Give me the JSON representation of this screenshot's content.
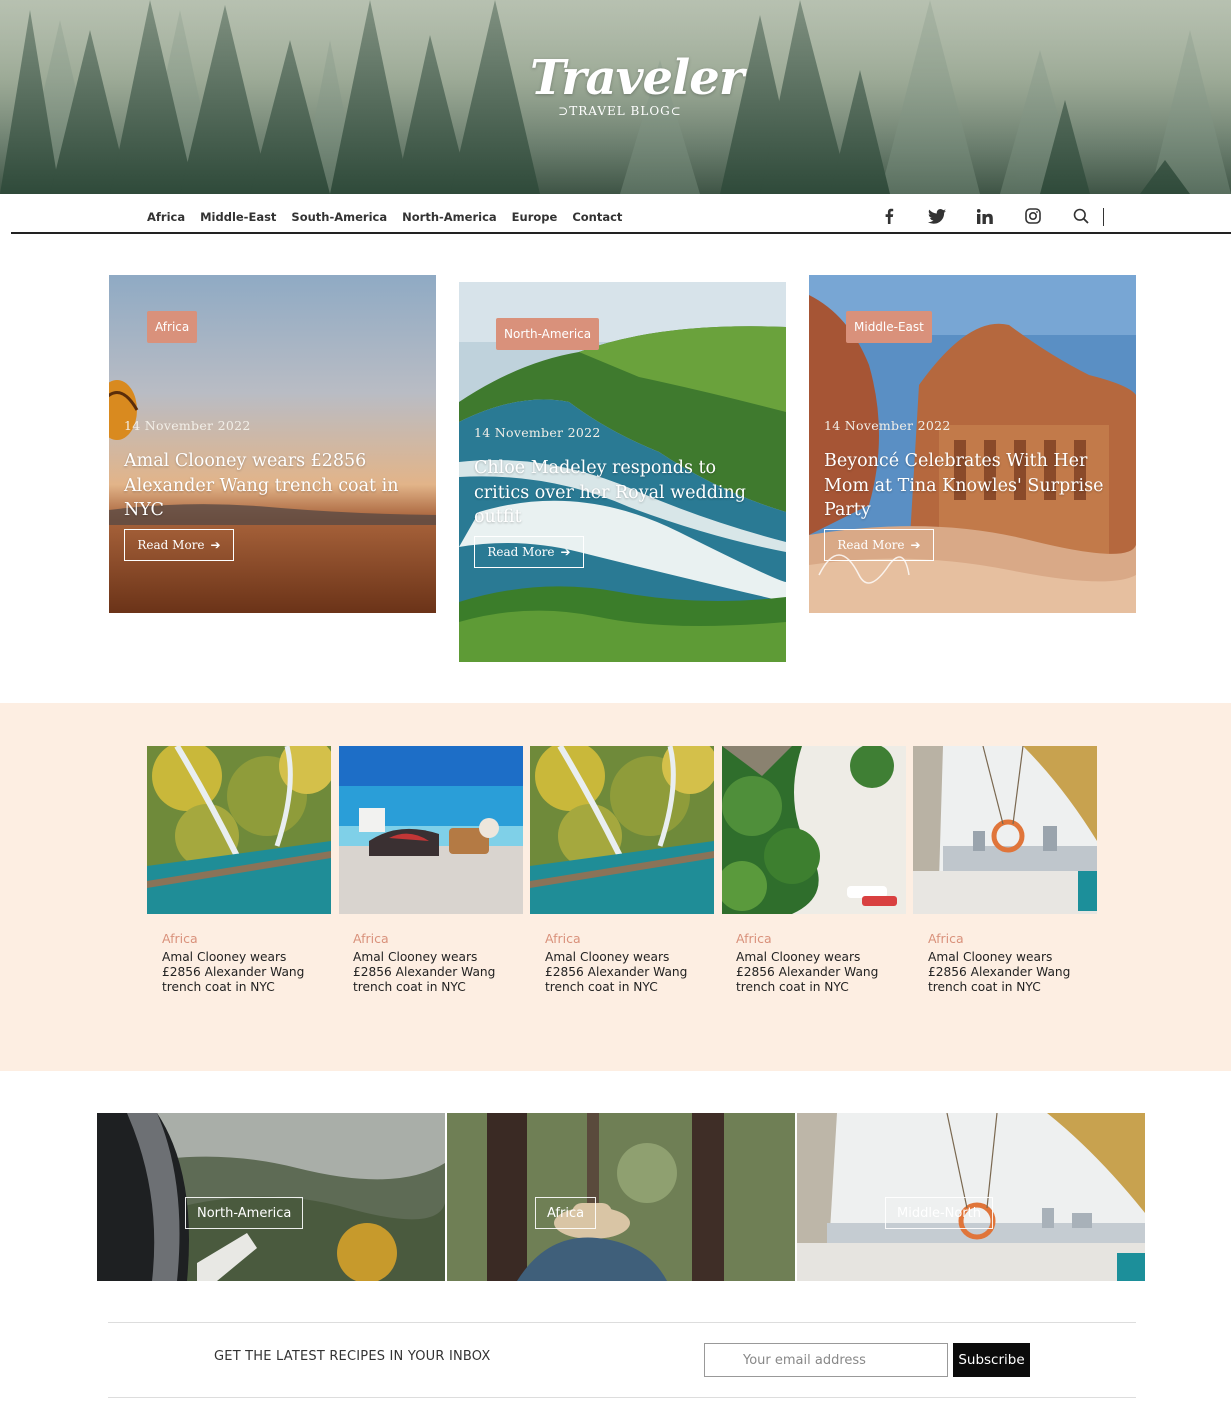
{
  "header": {
    "logo_main": "Traveler",
    "logo_sub": "TRAVEL BLOG"
  },
  "nav": {
    "links": [
      "Africa",
      "Middle-East",
      "South-America",
      "North-America",
      "Europe",
      "Contact"
    ],
    "social_icons": [
      "facebook-icon",
      "twitter-icon",
      "linkedin-icon",
      "instagram-icon",
      "search-icon"
    ]
  },
  "featured": [
    {
      "category": "Africa",
      "date": "14 November 2022",
      "title": "Amal Clooney wears £2856 Alexander Wang trench coat in NYC",
      "button": "Read More"
    },
    {
      "category": "North-America",
      "date": "14 November 2022",
      "title": "Chloe Madeley responds to critics over her Royal wedding outfit",
      "button": "Read More"
    },
    {
      "category": "Middle-East",
      "date": "14 November 2022",
      "title": "Beyoncé Celebrates With Her Mom at Tina Knowles' Surprise Party",
      "button": "Read More"
    }
  ],
  "posts": [
    {
      "category": "Africa",
      "title": "Amal Clooney wears £2856 Alexander Wang trench coat in NYC"
    },
    {
      "category": "Africa",
      "title": "Amal Clooney wears £2856 Alexander Wang trench coat in NYC"
    },
    {
      "category": "Africa",
      "title": "Amal Clooney wears £2856 Alexander Wang trench coat in NYC"
    },
    {
      "category": "Africa",
      "title": "Amal Clooney wears £2856 Alexander Wang trench coat in NYC"
    },
    {
      "category": "Africa",
      "title": "Amal Clooney wears £2856 Alexander Wang trench coat in NYC"
    }
  ],
  "categories": [
    "North-America",
    "Africa",
    "Middle-North"
  ],
  "newsletter": {
    "text": "GET THE LATEST RECIPES IN YOUR INBOX",
    "placeholder": "Your email address",
    "button": "Subscribe"
  },
  "colors": {
    "accent": "#d9917b",
    "strip_bg": "#fdeee2",
    "subscribe_bg": "#0b0b0b"
  }
}
